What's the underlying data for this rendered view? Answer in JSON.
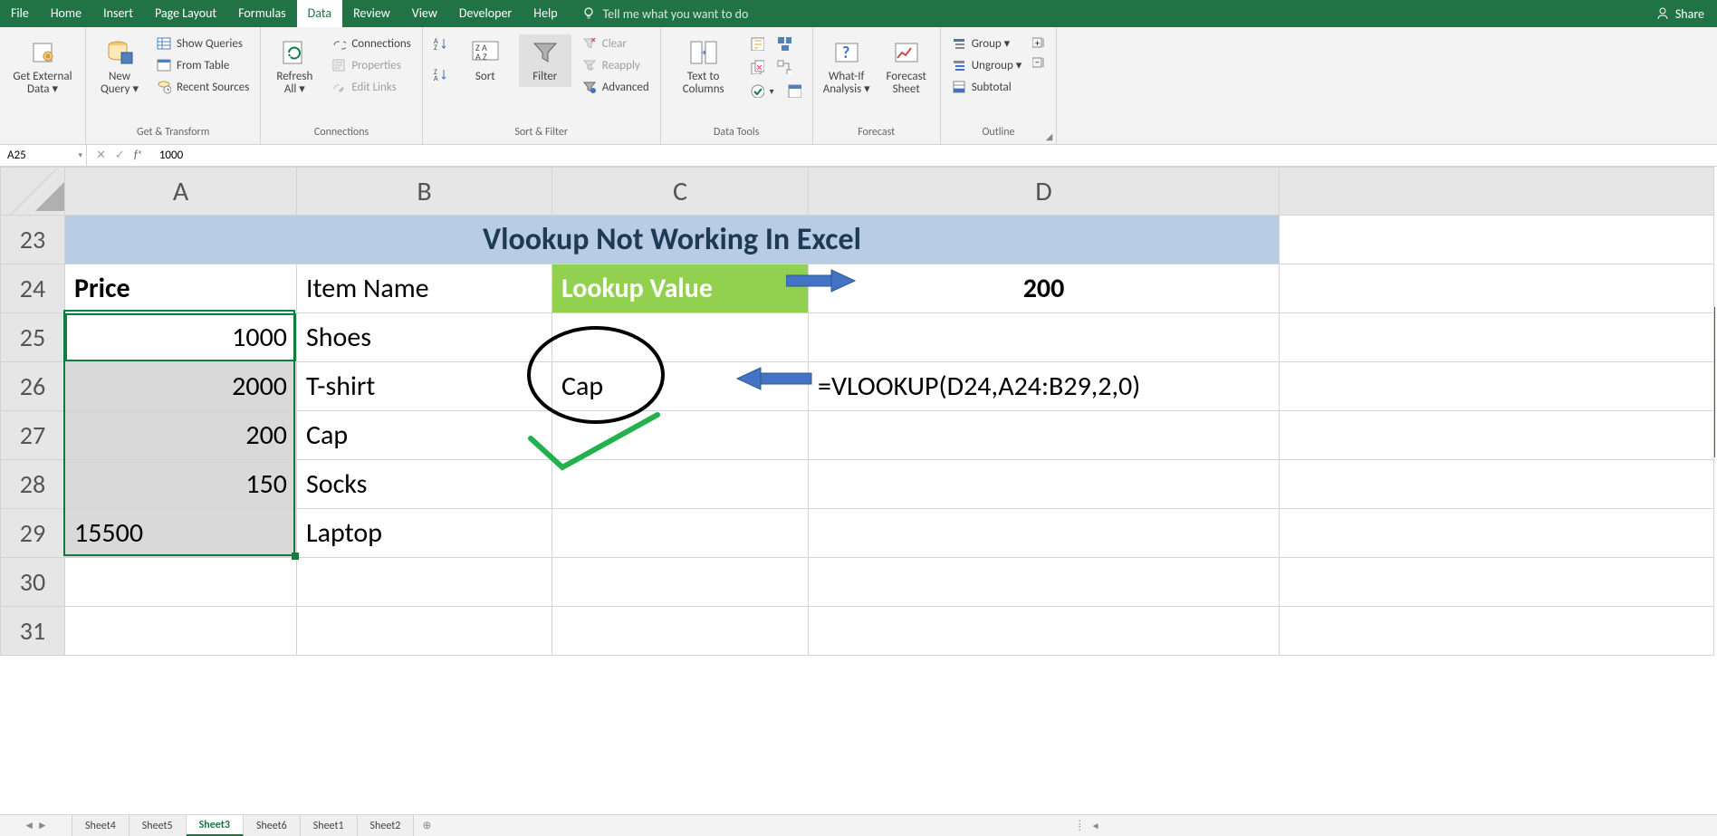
{
  "menu": {
    "file": "File",
    "home": "Home",
    "insert": "Insert",
    "page_layout": "Page Layout",
    "formulas": "Formulas",
    "data": "Data",
    "review": "Review",
    "view": "View",
    "developer": "Developer",
    "help": "Help",
    "tell": "Tell me what you want to do",
    "share": "Share"
  },
  "ribbon": {
    "get_external": "Get External\nData ▾",
    "new_query": "New\nQuery ▾",
    "show_queries": "Show Queries",
    "from_table": "From Table",
    "recent_sources": "Recent Sources",
    "grp_transform": "Get & Transform",
    "refresh_all": "Refresh\nAll ▾",
    "connections": "Connections",
    "properties": "Properties",
    "edit_links": "Edit Links",
    "grp_connections": "Connections",
    "sort_az": "A↓Z",
    "sort_za": "Z↓A",
    "sort": "Sort",
    "filter": "Filter",
    "clear": "Clear",
    "reapply": "Reapply",
    "advanced": "Advanced",
    "grp_sortfilter": "Sort & Filter",
    "text_to_cols": "Text to\nColumns",
    "grp_datatools": "Data Tools",
    "whatif": "What-If\nAnalysis ▾",
    "forecast": "Forecast\nSheet",
    "grp_forecast": "Forecast",
    "group": "Group ▾",
    "ungroup": "Ungroup ▾",
    "subtotal": "Subtotal",
    "grp_outline": "Outline"
  },
  "formula_bar": {
    "ref": "A25",
    "value": "1000"
  },
  "columns": [
    "A",
    "B",
    "C",
    "D"
  ],
  "rows": [
    "23",
    "24",
    "25",
    "26",
    "27",
    "28",
    "29",
    "30",
    "31"
  ],
  "cells": {
    "title": "Vlookup Not Working In Excel",
    "A24": "Price",
    "B24": "Item Name",
    "C24": "Lookup Value",
    "D24": "200",
    "A25": "1000",
    "B25": "Shoes",
    "A26": "2000",
    "B26": "T-shirt",
    "C26": "Cap",
    "D26": "=VLOOKUP(D24,A24:B29,2,0)",
    "A27": "200",
    "B27": "Cap",
    "A28": "150",
    "B28": "Socks",
    "A29": "15500",
    "B29": "Laptop"
  },
  "sheet_tabs": [
    "Sheet4",
    "Sheet5",
    "Sheet3",
    "Sheet6",
    "Sheet1",
    "Sheet2"
  ],
  "active_sheet": "Sheet3",
  "chart_data": {
    "type": "table",
    "title": "Vlookup Not Working In Excel",
    "columns": [
      "Price",
      "Item Name"
    ],
    "data": [
      {
        "Price": 1000,
        "Item Name": "Shoes"
      },
      {
        "Price": 2000,
        "Item Name": "T-shirt"
      },
      {
        "Price": 200,
        "Item Name": "Cap"
      },
      {
        "Price": 150,
        "Item Name": "Socks"
      },
      {
        "Price": 15500,
        "Item Name": "Laptop"
      }
    ],
    "lookup_value": 200,
    "formula": "=VLOOKUP(D24,A24:B29,2,0)",
    "result": "Cap"
  }
}
